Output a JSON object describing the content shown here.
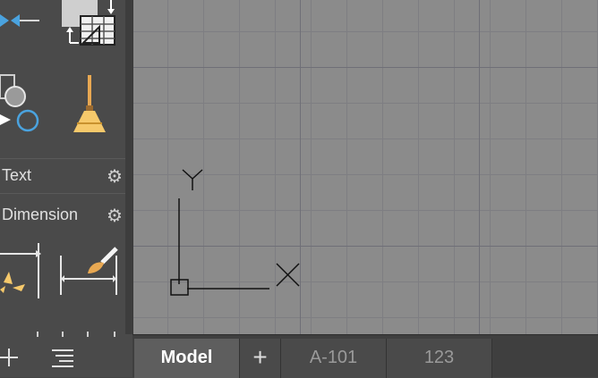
{
  "sidebar": {
    "sections": [
      {
        "label": "Text"
      },
      {
        "label": "Dimension"
      }
    ]
  },
  "tabs": [
    {
      "label": "Model",
      "active": true
    },
    {
      "label": "A-101",
      "active": false
    },
    {
      "label": "123",
      "active": false
    }
  ],
  "ucs": {
    "x_label": "X",
    "y_label": "Y"
  },
  "colors": {
    "accent": "#4aa3df",
    "brush": "#e8a852",
    "canvas": "#8b8b8b",
    "grid": "#6f6f77"
  }
}
